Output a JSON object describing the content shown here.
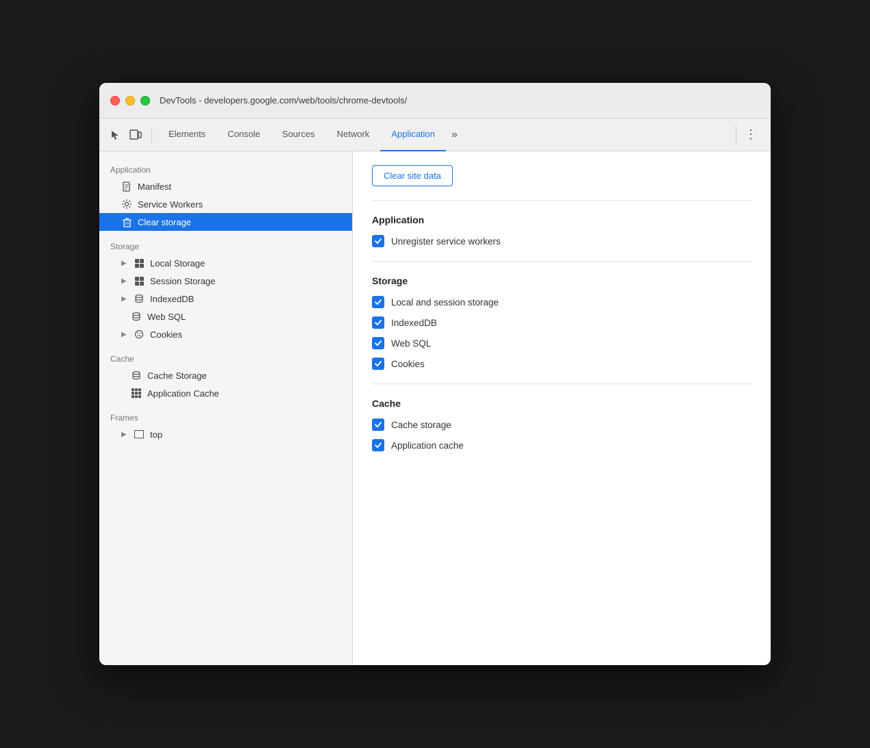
{
  "window": {
    "title": "DevTools - developers.google.com/web/tools/chrome-devtools/"
  },
  "toolbar": {
    "tabs": [
      {
        "id": "elements",
        "label": "Elements",
        "active": false
      },
      {
        "id": "console",
        "label": "Console",
        "active": false
      },
      {
        "id": "sources",
        "label": "Sources",
        "active": false
      },
      {
        "id": "network",
        "label": "Network",
        "active": false
      },
      {
        "id": "application",
        "label": "Application",
        "active": true
      }
    ],
    "more_label": "»",
    "menu_label": "⋮"
  },
  "sidebar": {
    "application_section": "Application",
    "items_application": [
      {
        "id": "manifest",
        "label": "Manifest",
        "icon": "document",
        "indented": 1
      },
      {
        "id": "service-workers",
        "label": "Service Workers",
        "icon": "gear",
        "indented": 1
      },
      {
        "id": "clear-storage",
        "label": "Clear storage",
        "icon": "trash",
        "active": true,
        "indented": 1
      }
    ],
    "storage_section": "Storage",
    "items_storage": [
      {
        "id": "local-storage",
        "label": "Local Storage",
        "icon": "grid",
        "arrow": true,
        "indented": 1
      },
      {
        "id": "session-storage",
        "label": "Session Storage",
        "icon": "grid",
        "arrow": true,
        "indented": 1
      },
      {
        "id": "indexeddb",
        "label": "IndexedDB",
        "icon": "db",
        "arrow": true,
        "indented": 1
      },
      {
        "id": "web-sql",
        "label": "Web SQL",
        "icon": "db",
        "indented": 1
      },
      {
        "id": "cookies",
        "label": "Cookies",
        "icon": "cookie",
        "arrow": true,
        "indented": 1
      }
    ],
    "cache_section": "Cache",
    "items_cache": [
      {
        "id": "cache-storage",
        "label": "Cache Storage",
        "icon": "db",
        "indented": 1
      },
      {
        "id": "app-cache",
        "label": "Application Cache",
        "icon": "grid",
        "indented": 1
      }
    ],
    "frames_section": "Frames",
    "items_frames": [
      {
        "id": "top",
        "label": "top",
        "icon": "frame",
        "arrow": true,
        "indented": 1
      }
    ]
  },
  "panel": {
    "clear_button": "Clear site data",
    "application_title": "Application",
    "storage_title": "Storage",
    "cache_title": "Cache",
    "checkboxes": {
      "application": [
        {
          "id": "unregister-sw",
          "label": "Unregister service workers",
          "checked": true
        }
      ],
      "storage": [
        {
          "id": "local-session",
          "label": "Local and session storage",
          "checked": true
        },
        {
          "id": "indexeddb",
          "label": "IndexedDB",
          "checked": true
        },
        {
          "id": "web-sql",
          "label": "Web SQL",
          "checked": true
        },
        {
          "id": "cookies",
          "label": "Cookies",
          "checked": true
        }
      ],
      "cache": [
        {
          "id": "cache-storage",
          "label": "Cache storage",
          "checked": true
        },
        {
          "id": "app-cache",
          "label": "Application cache",
          "checked": true
        }
      ]
    }
  }
}
